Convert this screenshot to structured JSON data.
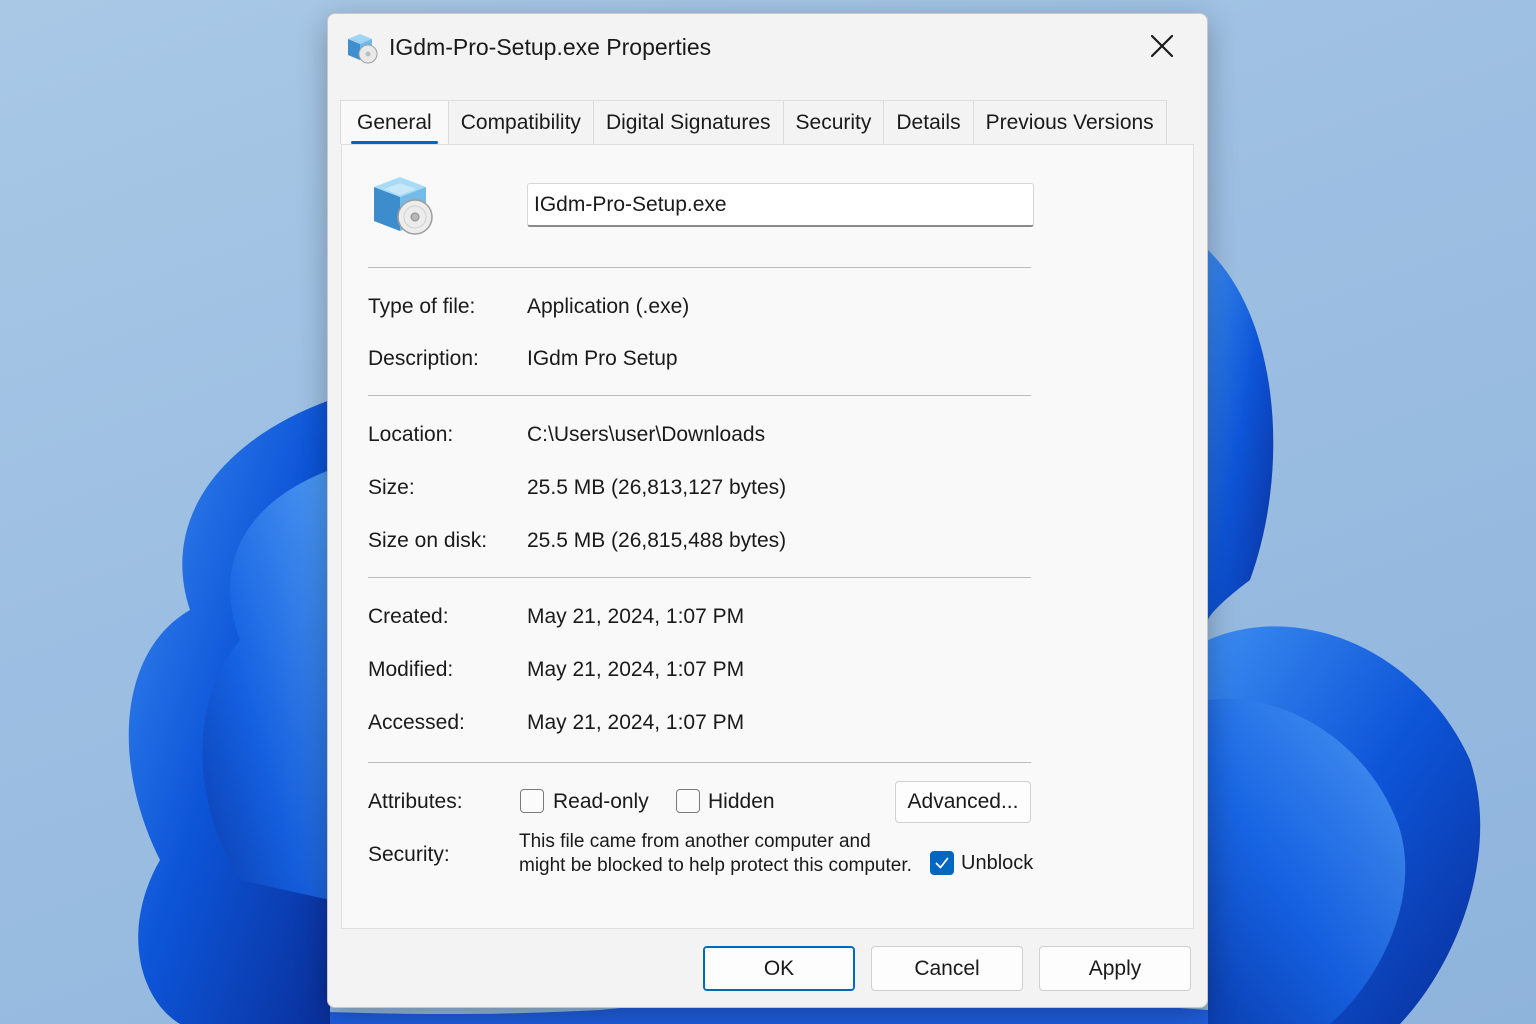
{
  "window": {
    "title": "IGdm-Pro-Setup.exe Properties"
  },
  "tabs": [
    {
      "label": "General",
      "active": true
    },
    {
      "label": "Compatibility",
      "active": false
    },
    {
      "label": "Digital Signatures",
      "active": false
    },
    {
      "label": "Security",
      "active": false
    },
    {
      "label": "Details",
      "active": false
    },
    {
      "label": "Previous Versions",
      "active": false
    }
  ],
  "general": {
    "file_name": "IGdm-Pro-Setup.exe",
    "type_label": "Type of file:",
    "type_value": "Application (.exe)",
    "description_label": "Description:",
    "description_value": "IGdm Pro Setup",
    "location_label": "Location:",
    "location_value": "C:\\Users\\user\\Downloads",
    "size_label": "Size:",
    "size_value": "25.5 MB (26,813,127 bytes)",
    "size_on_disk_label": "Size on disk:",
    "size_on_disk_value": "25.5 MB (26,815,488 bytes)",
    "created_label": "Created:",
    "created_value": "May 21, 2024, 1:07 PM",
    "modified_label": "Modified:",
    "modified_value": "May 21, 2024, 1:07 PM",
    "accessed_label": "Accessed:",
    "accessed_value": "May 21, 2024, 1:07 PM",
    "attributes_label": "Attributes:",
    "readonly_label": "Read-only",
    "readonly_checked": false,
    "hidden_label": "Hidden",
    "hidden_checked": false,
    "advanced_label": "Advanced...",
    "security_label": "Security:",
    "security_text": "This file came from another computer and might be blocked to help protect this computer.",
    "unblock_label": "Unblock",
    "unblock_checked": true
  },
  "footer": {
    "ok_label": "OK",
    "cancel_label": "Cancel",
    "apply_label": "Apply"
  },
  "colors": {
    "accent": "#0067c0",
    "wallpaper_bloom": "#0a4fd6"
  },
  "icons": {
    "title": "installer-package-icon",
    "file": "installer-package-icon",
    "close": "close-icon",
    "check": "checkmark-icon"
  }
}
